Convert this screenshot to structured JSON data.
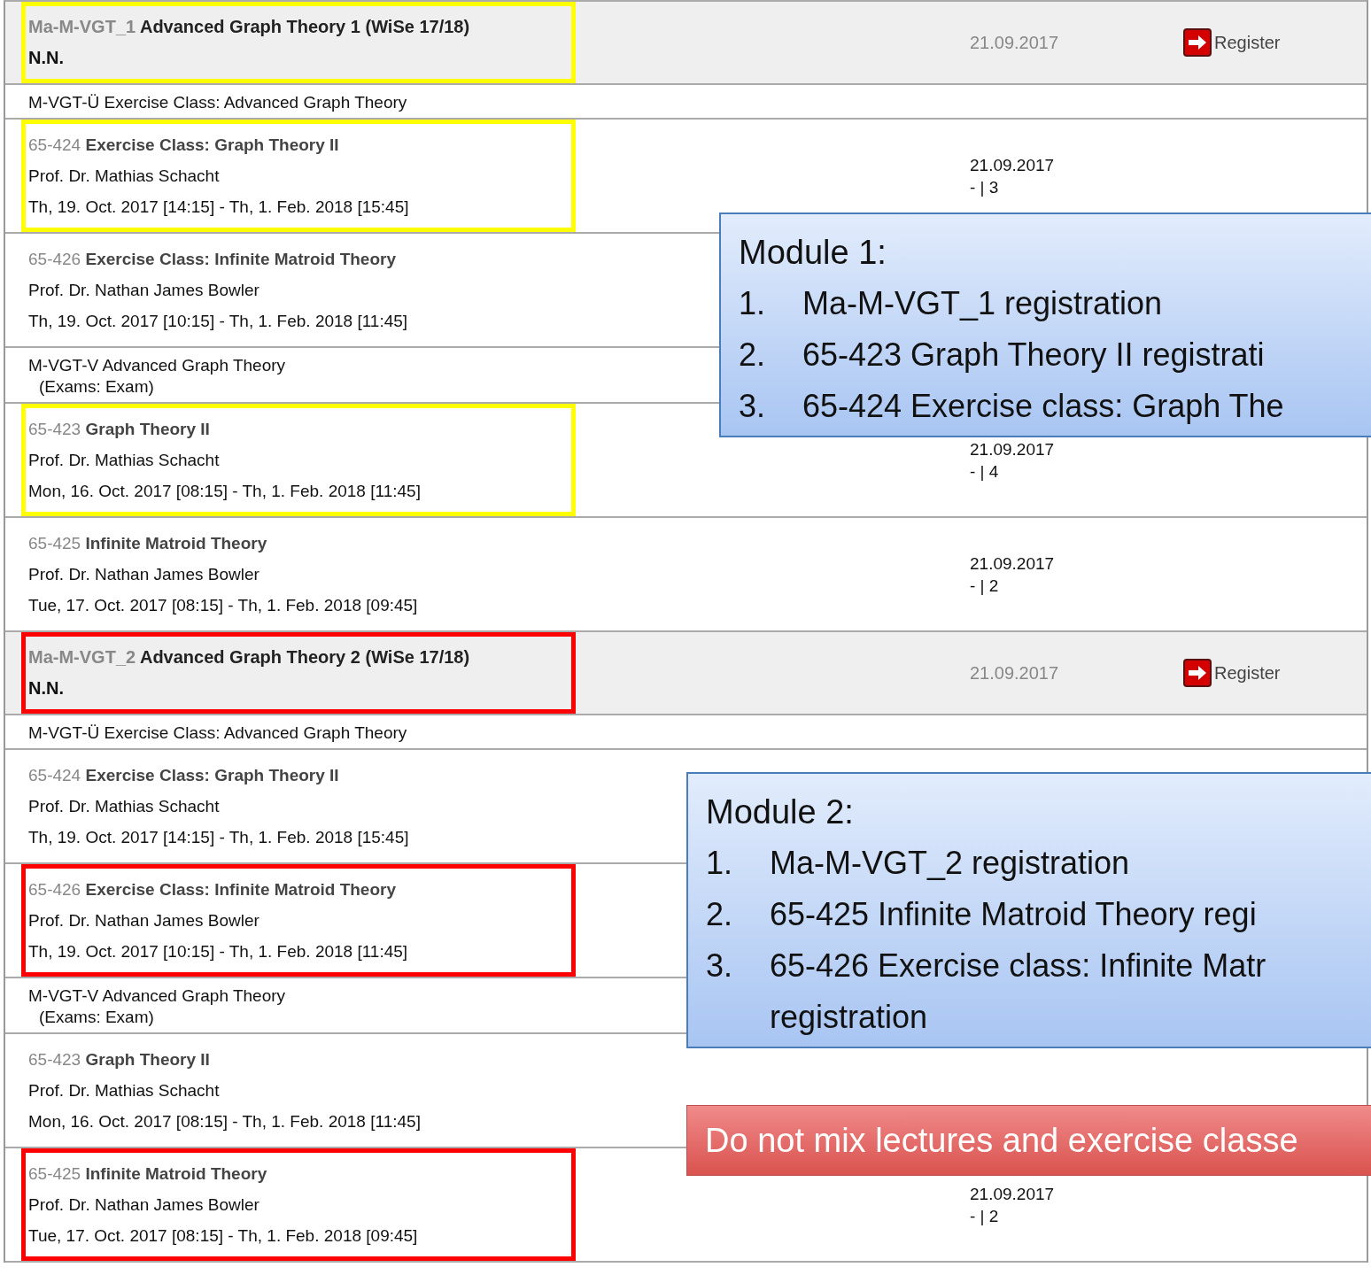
{
  "rows": [
    {
      "kind": "module",
      "code": "Ma-M-VGT_1",
      "title": "Advanced Graph Theory 1 (WiSe 17/18)",
      "person": "N.N.",
      "date": "21.09.2017",
      "action": "Register",
      "color": "#ffff00"
    },
    {
      "kind": "section",
      "label": "M-VGT-Ü Exercise Class: Advanced Graph Theory"
    },
    {
      "kind": "course",
      "code": "65-424",
      "title": "Exercise Class: Graph Theory II",
      "person": "Prof. Dr. Mathias Schacht",
      "schedule": "Th, 19. Oct. 2017 [14:15] - Th, 1. Feb. 2018 [15:45]",
      "date": "21.09.2017",
      "count": "- | 3",
      "color": "#ffff00"
    },
    {
      "kind": "course",
      "code": "65-426",
      "title": "Exercise Class: Infinite Matroid Theory",
      "person": "Prof. Dr. Nathan James Bowler",
      "schedule": "Th, 19. Oct. 2017 [10:15] - Th, 1. Feb. 2018 [11:45]"
    },
    {
      "kind": "section",
      "label": "M-VGT-V Advanced Graph Theory",
      "note": "(Exams: Exam)"
    },
    {
      "kind": "course",
      "code": "65-423",
      "title": "Graph Theory II",
      "person": "Prof. Dr. Mathias Schacht",
      "schedule": "Mon, 16. Oct. 2017 [08:15] - Th, 1. Feb. 2018 [11:45]",
      "date": "21.09.2017",
      "count": "- | 4",
      "color": "#ffff00"
    },
    {
      "kind": "course",
      "code": "65-425",
      "title": "Infinite Matroid Theory",
      "person": "Prof. Dr. Nathan James Bowler",
      "schedule": "Tue, 17. Oct. 2017 [08:15] - Th, 1. Feb. 2018 [09:45]",
      "date": "21.09.2017",
      "count": "- | 2"
    },
    {
      "kind": "module",
      "code": "Ma-M-VGT_2",
      "title": "Advanced Graph Theory 2 (WiSe 17/18)",
      "person": "N.N.",
      "date": "21.09.2017",
      "action": "Register",
      "color": "#ff0000"
    },
    {
      "kind": "section",
      "label": "M-VGT-Ü Exercise Class: Advanced Graph Theory"
    },
    {
      "kind": "course",
      "code": "65-424",
      "title": "Exercise Class: Graph Theory II",
      "person": "Prof. Dr. Mathias Schacht",
      "schedule": "Th, 19. Oct. 2017 [14:15] - Th, 1. Feb. 2018 [15:45]"
    },
    {
      "kind": "course",
      "code": "65-426",
      "title": "Exercise Class: Infinite Matroid Theory",
      "person": "Prof. Dr. Nathan James Bowler",
      "schedule": "Th, 19. Oct. 2017 [10:15] - Th, 1. Feb. 2018 [11:45]",
      "color": "#ff0000"
    },
    {
      "kind": "section",
      "label": "M-VGT-V Advanced Graph Theory",
      "note": "(Exams: Exam)"
    },
    {
      "kind": "course",
      "code": "65-423",
      "title": "Graph Theory II",
      "person": "Prof. Dr. Mathias Schacht",
      "schedule": "Mon, 16. Oct. 2017 [08:15] - Th, 1. Feb. 2018 [11:45]"
    },
    {
      "kind": "course",
      "code": "65-425",
      "title": "Infinite Matroid Theory",
      "person": "Prof. Dr. Nathan James Bowler",
      "schedule": "Tue, 17. Oct. 2017 [08:15] - Th, 1. Feb. 2018 [09:45]",
      "date": "21.09.2017",
      "count": "- | 2",
      "color": "#ff0000"
    }
  ],
  "callouts": [
    {
      "title": "Module 1:",
      "items": [
        {
          "number": "1.",
          "lines": [
            "Ma-M-VGT_1 registration"
          ]
        },
        {
          "number": "2.",
          "lines": [
            "65-423 Graph Theory II registrati"
          ]
        },
        {
          "number": "3.",
          "lines": [
            "65-424 Exercise class: Graph The"
          ]
        }
      ]
    },
    {
      "title": "Module 2:",
      "items": [
        {
          "number": "1.",
          "lines": [
            "Ma-M-VGT_2 registration"
          ]
        },
        {
          "number": "2.",
          "lines": [
            "65-425 Infinite Matroid Theory regi"
          ]
        },
        {
          "number": "3.",
          "lines": [
            "65-426 Exercise class: Infinite Matr",
            "registration"
          ]
        }
      ]
    }
  ],
  "warning": "Do not mix lectures and exercise classe"
}
